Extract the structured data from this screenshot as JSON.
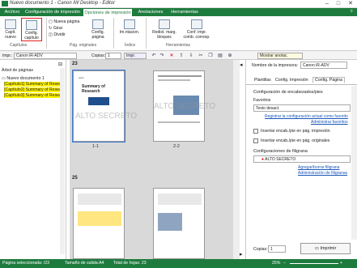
{
  "window": {
    "title": "Nuevo documento 1 - Canon iW Desktop - Editor",
    "controls": {
      "minimize": "–",
      "maximize": "□",
      "close": "✕",
      "help": "?"
    }
  },
  "tabs": [
    {
      "label": "Archivo"
    },
    {
      "label": "Configuración de impresión"
    },
    {
      "label": "Opciones de impresión"
    },
    {
      "label": "Anotaciones"
    },
    {
      "label": "Herramientas"
    }
  ],
  "ribbon": {
    "capt_nuevo": "Capít. nuevo",
    "capt_capitulo": "Config. capítulo",
    "nueva_pagina": "Nueva página",
    "girar": "Girar",
    "dividir": "Dividir",
    "config_pagina": "Config. página",
    "imanes": "Im.ntacion.",
    "redistrib": "Redist. marg. bloques",
    "config_impr": "Conf. impr. comb. corresp.",
    "groups": {
      "capitulo": "Capítulos",
      "pag_originales": "Pág. originales",
      "indice": "Índice",
      "herramientas": "Herramientas"
    }
  },
  "toolbar": {
    "impr_label": "Impr.:",
    "printer": "Canon iR-ADV",
    "copies_label": "Copias:",
    "copies": "1",
    "impr_btn": "Impr.",
    "mostrar_anotac": "Mostrar anotac."
  },
  "left": {
    "header": "Árbol de páginas",
    "items": [
      {
        "label": "Nuevo documento 1"
      },
      {
        "label": "[Capítulo1] Summary of Resea"
      },
      {
        "label": "[Capítulo2] Summary of Resea"
      },
      {
        "label": "[Capítulo3] Summary of Resea"
      }
    ]
  },
  "pages": {
    "row1": {
      "label": "23",
      "p1_title": "Summary of Research",
      "p1_sub": "Summary of Research",
      "p1_caption": "1-1",
      "p2_caption": "2-2"
    },
    "row2": {
      "label": "25"
    },
    "watermark": "ALTO SECRETO"
  },
  "right": {
    "printer_label": "Nombre de la impresora:",
    "printer": "Canon iR-ADV",
    "tabs": [
      {
        "label": "Plantillas"
      },
      {
        "label": "Config. Impresión"
      },
      {
        "label": "Config. Página"
      }
    ],
    "header_footer_title": "Configuración de encabezados/pies",
    "favoritos": "Favoritos",
    "favoritos_value": "Texto desact.",
    "registrar_link": "Registrar la configuración actual como favorito",
    "administrar_link": "Administrar favoritos",
    "chk1": "Insertar encab./pie en pág. impresión",
    "chk2": "Insertar encab./pie en pág. originales",
    "filigrana_title": "Configuraciones de filigrana",
    "filigrana_value": "ALTO SECRETO",
    "agregar_link": "Agregar/borrar filigrana",
    "admin_filigrana_link": "Administración de filigranas",
    "copias_label": "Copias:",
    "copias": "1",
    "imprimir": "Imprimir"
  },
  "status": {
    "selected": "Página seleccionada: /23",
    "size": "Tamaño de salida:A4",
    "total": "Total de hojas: 23",
    "zoom": "25%"
  },
  "colors": {
    "accent": "#1e7b3e",
    "highlight": "#fff200",
    "link": "#1a56b8"
  }
}
